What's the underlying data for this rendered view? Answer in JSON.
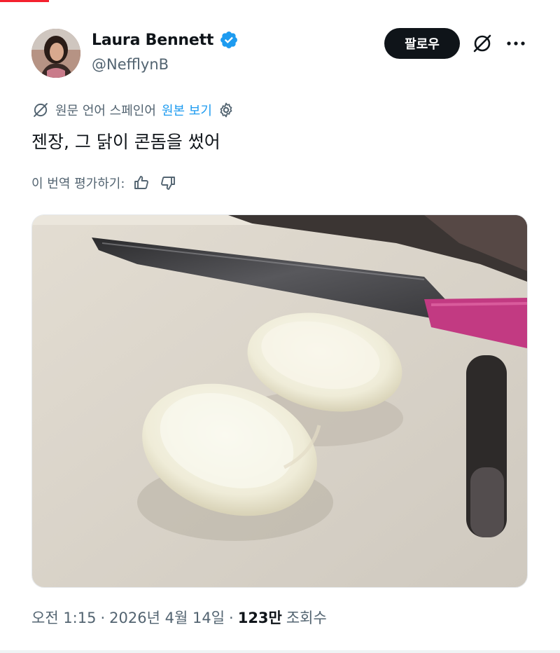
{
  "author": {
    "display_name": "Laura Bennett",
    "handle": "@NefflynB",
    "verified": true
  },
  "actions": {
    "follow_label": "팔로우",
    "grok_icon": "grok-icon",
    "more_icon": "more-icon"
  },
  "translation": {
    "source_label": "원문 언어 스페인어",
    "view_original_link": "원본 보기",
    "settings_icon": "gear-icon"
  },
  "tweet": {
    "text": "젠장, 그 닭이 콘돔을 썼어"
  },
  "rating": {
    "label": "이 번역 평가하기:",
    "like_icon": "thumbs-up-icon",
    "dislike_icon": "thumbs-down-icon"
  },
  "media": {
    "description_icon": "photo"
  },
  "meta": {
    "time": "오전 1:15",
    "separator": "·",
    "date": "2026년 4월 14일",
    "views_count": "123만",
    "views_label": "조회수"
  },
  "colors": {
    "accent": "#1d9bf0",
    "text": "#0f1419",
    "secondary": "#536471",
    "knife_handle": "#c8337f"
  }
}
